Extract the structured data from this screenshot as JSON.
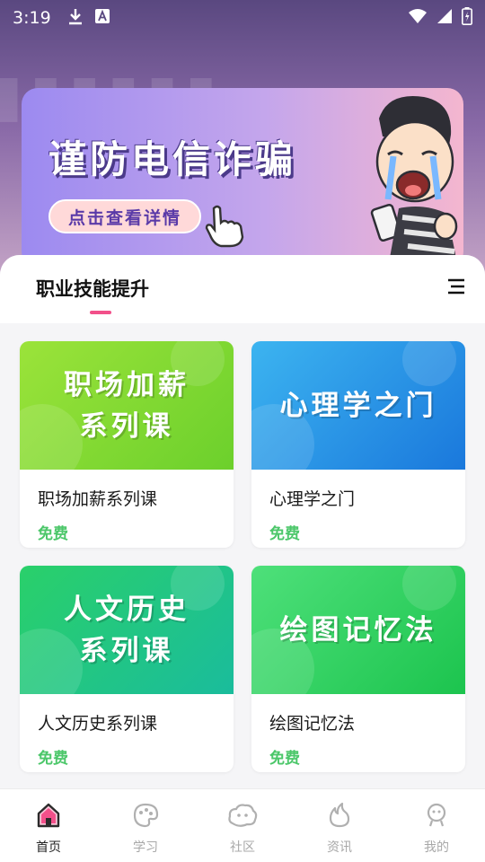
{
  "status_bar": {
    "time": "3:19",
    "icons": [
      "download-icon",
      "font-icon",
      "wifi-icon",
      "signal-icon",
      "battery-icon"
    ]
  },
  "banner": {
    "title": "谨防电信诈骗",
    "cta": "点击查看详情"
  },
  "section": {
    "title": "职业技能提升",
    "accent_color": "#f2508a"
  },
  "courses": [
    {
      "thumb_line1": "职场加薪",
      "thumb_line2": "系列课",
      "name": "职场加薪系列课",
      "price": "免费",
      "thumb_color": "#7fd42a"
    },
    {
      "thumb_line1": "心理学之门",
      "thumb_line2": "",
      "name": "心理学之门",
      "price": "免费",
      "thumb_color": "#1e8ee6"
    },
    {
      "thumb_line1": "人文历史",
      "thumb_line2": "系列课",
      "name": "人文历史系列课",
      "price": "免费",
      "thumb_color": "#22c87a"
    },
    {
      "thumb_line1": "绘图记忆法",
      "thumb_line2": "",
      "name": "绘图记忆法",
      "price": "免费",
      "thumb_color": "#2bd460"
    }
  ],
  "nav": [
    {
      "label": "首页",
      "icon": "home-icon",
      "active": true
    },
    {
      "label": "学习",
      "icon": "palette-icon",
      "active": false
    },
    {
      "label": "社区",
      "icon": "community-icon",
      "active": false
    },
    {
      "label": "资讯",
      "icon": "flame-icon",
      "active": false
    },
    {
      "label": "我的",
      "icon": "profile-icon",
      "active": false
    }
  ],
  "colors": {
    "price_green": "#4cc76a",
    "nav_active": "#222222",
    "nav_inactive": "#a8a8a8"
  }
}
